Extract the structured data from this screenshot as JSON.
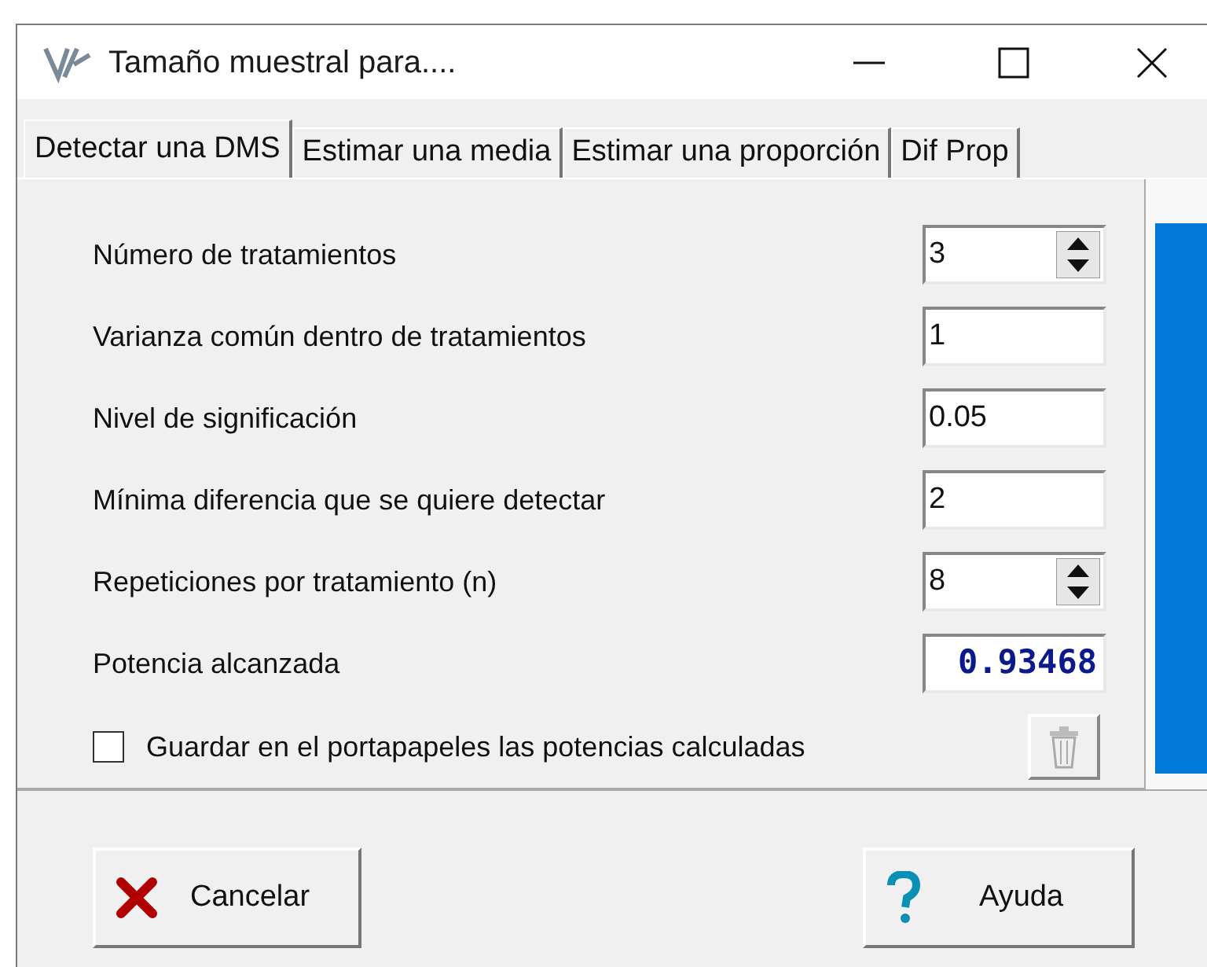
{
  "window": {
    "title": "Tamaño muestral para...."
  },
  "tabs": [
    {
      "label": "Detectar una DMS",
      "selected": true
    },
    {
      "label": "Estimar una media",
      "selected": false
    },
    {
      "label": "Estimar una proporción",
      "selected": false
    },
    {
      "label": "Dif Prop",
      "selected": false
    }
  ],
  "fields": [
    {
      "label": "Número de tratamientos",
      "value": "3",
      "kind": "spin"
    },
    {
      "label": "Varianza común dentro de tratamientos",
      "value": "1",
      "kind": "text"
    },
    {
      "label": "Nivel de significación",
      "value": "0.05",
      "kind": "text"
    },
    {
      "label": "Mínima diferencia que se quiere detectar",
      "value": "2",
      "kind": "text"
    },
    {
      "label": "Repeticiones por tratamiento (n)",
      "value": "8",
      "kind": "spin"
    },
    {
      "label": "Potencia alcanzada",
      "value": "0.93468",
      "kind": "result"
    }
  ],
  "clipboard_option": {
    "label": "Guardar en el portapapeles las potencias calculadas",
    "checked": false
  },
  "buttons": [
    {
      "label": "Cancelar",
      "kind": "cancel"
    },
    {
      "label": "Ayuda",
      "kind": "help"
    }
  ]
}
